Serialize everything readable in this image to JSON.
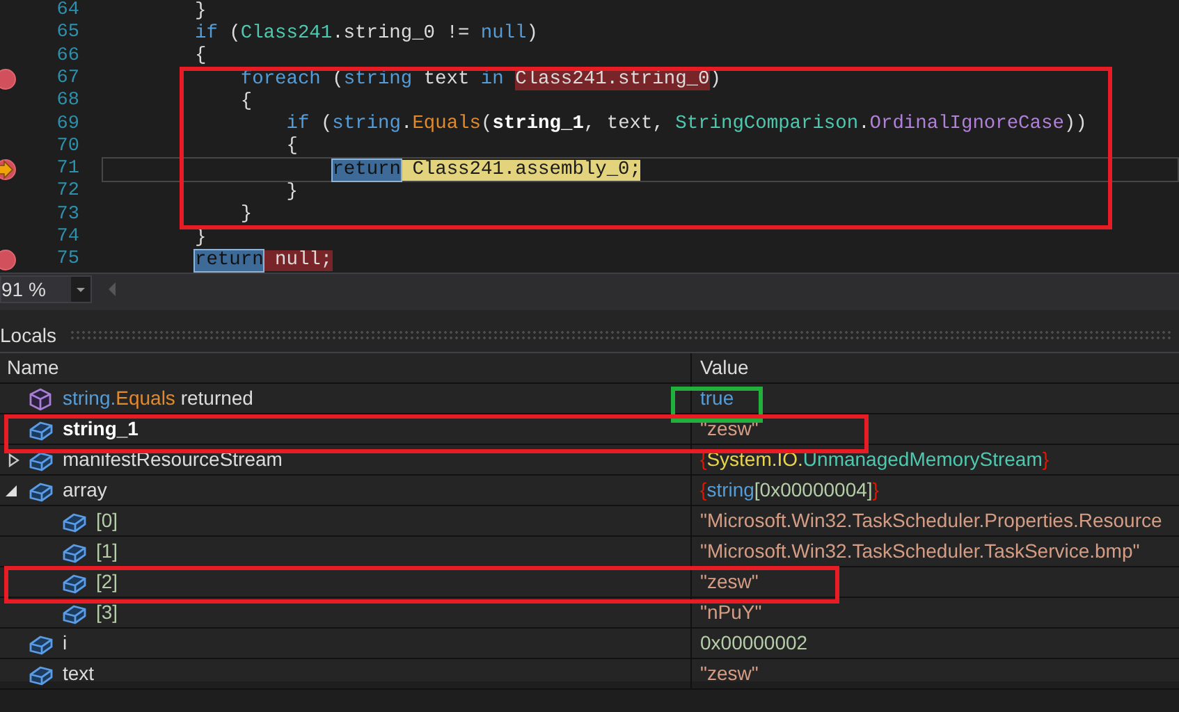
{
  "editor": {
    "lines": [
      {
        "number": "64",
        "breakpoint": false,
        "current": false,
        "tokens": [
          {
            "text": "}",
            "kind": "plain"
          }
        ]
      },
      {
        "number": "65",
        "breakpoint": false,
        "current": false,
        "tokens": [
          {
            "text": "if",
            "kind": "keyword"
          },
          {
            "text": " (",
            "kind": "plain"
          },
          {
            "text": "Class241",
            "kind": "type"
          },
          {
            "text": ".string_0 != ",
            "kind": "plain"
          },
          {
            "text": "null",
            "kind": "keyword"
          },
          {
            "text": ")",
            "kind": "plain"
          }
        ]
      },
      {
        "number": "66",
        "breakpoint": false,
        "current": false,
        "tokens": [
          {
            "text": "{",
            "kind": "plain"
          }
        ]
      },
      {
        "number": "67",
        "breakpoint": true,
        "current": false,
        "tokens": [
          {
            "text": "foreach",
            "kind": "keyword"
          },
          {
            "text": " (",
            "kind": "plain"
          },
          {
            "text": "string",
            "kind": "keyword"
          },
          {
            "text": " text ",
            "kind": "plain"
          },
          {
            "text": "in ",
            "kind": "keyword"
          },
          {
            "text": "Class241.string_0",
            "kind": "breakpoint-span"
          },
          {
            "text": ")",
            "kind": "plain"
          }
        ]
      },
      {
        "number": "68",
        "breakpoint": false,
        "current": false,
        "tokens": [
          {
            "text": "{",
            "kind": "plain"
          }
        ]
      },
      {
        "number": "69",
        "breakpoint": false,
        "current": false,
        "tokens": [
          {
            "text": "if",
            "kind": "keyword"
          },
          {
            "text": " (",
            "kind": "plain"
          },
          {
            "text": "string",
            "kind": "keyword"
          },
          {
            "text": ".",
            "kind": "plain"
          },
          {
            "text": "Equals",
            "kind": "method"
          },
          {
            "text": "(",
            "kind": "plain"
          },
          {
            "text": "string_1",
            "kind": "bold"
          },
          {
            "text": ", text, ",
            "kind": "plain"
          },
          {
            "text": "StringComparison",
            "kind": "type"
          },
          {
            "text": ".",
            "kind": "plain"
          },
          {
            "text": "OrdinalIgnoreCase",
            "kind": "enum"
          },
          {
            "text": "))",
            "kind": "plain"
          }
        ]
      },
      {
        "number": "70",
        "breakpoint": false,
        "current": false,
        "tokens": [
          {
            "text": "{",
            "kind": "plain"
          }
        ]
      },
      {
        "number": "71",
        "breakpoint": true,
        "current": true,
        "tokens": [
          {
            "text": "return",
            "kind": "step-keyword"
          },
          {
            "text": " Class241.assembly_0;",
            "kind": "current-span"
          }
        ]
      },
      {
        "number": "72",
        "breakpoint": false,
        "current": false,
        "tokens": [
          {
            "text": "}",
            "kind": "plain"
          }
        ]
      },
      {
        "number": "73",
        "breakpoint": false,
        "current": false,
        "tokens": [
          {
            "text": "}",
            "kind": "plain"
          }
        ]
      },
      {
        "number": "74",
        "breakpoint": false,
        "current": false,
        "tokens": [
          {
            "text": "}",
            "kind": "plain"
          }
        ]
      },
      {
        "number": "75",
        "breakpoint": true,
        "current": false,
        "tokens": [
          {
            "text": "return",
            "kind": "step-keyword"
          },
          {
            "text": " null;",
            "kind": "breakpoint-span"
          }
        ]
      }
    ]
  },
  "zoom": {
    "value": "91 %"
  },
  "locals": {
    "title": "Locals",
    "columns": [
      "Name",
      "Value"
    ],
    "rows": [
      {
        "kind": "return-value",
        "bold": false,
        "name": [
          {
            "text": "string.",
            "kind": "keyword"
          },
          {
            "text": "Equals",
            "kind": "method"
          },
          {
            "text": " returned",
            "kind": "plain"
          }
        ],
        "value": [
          {
            "text": "true",
            "kind": "keyword"
          }
        ]
      },
      {
        "kind": "variable",
        "bold": true,
        "name": [
          {
            "text": "string_1",
            "kind": "plain"
          }
        ],
        "value": [
          {
            "text": "\"zesw\"",
            "kind": "string"
          }
        ]
      },
      {
        "kind": "variable",
        "bold": false,
        "expanded": false,
        "name": [
          {
            "text": "manifestResourceStream",
            "kind": "plain"
          }
        ],
        "value": [
          {
            "text": "{",
            "kind": "brace"
          },
          {
            "text": "System.IO.",
            "kind": "namespace"
          },
          {
            "text": "UnmanagedMemoryStream",
            "kind": "type"
          },
          {
            "text": "}",
            "kind": "brace"
          }
        ]
      },
      {
        "kind": "variable",
        "bold": false,
        "expanded": true,
        "name": [
          {
            "text": "array",
            "kind": "plain"
          }
        ],
        "value": [
          {
            "text": "{",
            "kind": "brace"
          },
          {
            "text": "string",
            "kind": "keyword"
          },
          {
            "text": "[0x00000004]",
            "kind": "number"
          },
          {
            "text": "}",
            "kind": "brace"
          }
        ],
        "children": [
          {
            "kind": "variable",
            "bold": false,
            "name": [
              {
                "text": "[0]",
                "kind": "number"
              }
            ],
            "value": [
              {
                "text": "\"Microsoft.Win32.TaskScheduler.Properties.Resource",
                "kind": "string"
              }
            ]
          },
          {
            "kind": "variable",
            "bold": false,
            "name": [
              {
                "text": "[1]",
                "kind": "number"
              }
            ],
            "value": [
              {
                "text": "\"Microsoft.Win32.TaskScheduler.TaskService.bmp\"",
                "kind": "string"
              }
            ]
          },
          {
            "kind": "variable",
            "bold": false,
            "name": [
              {
                "text": "[2]",
                "kind": "number"
              }
            ],
            "value": [
              {
                "text": "\"zesw\"",
                "kind": "string"
              }
            ]
          },
          {
            "kind": "variable",
            "bold": false,
            "name": [
              {
                "text": "[3]",
                "kind": "number"
              }
            ],
            "value": [
              {
                "text": "\"nPuY\"",
                "kind": "string"
              }
            ]
          }
        ]
      },
      {
        "kind": "variable",
        "bold": false,
        "name": [
          {
            "text": "i",
            "kind": "plain"
          }
        ],
        "value": [
          {
            "text": "0x00000002",
            "kind": "number"
          }
        ]
      },
      {
        "kind": "variable",
        "bold": false,
        "name": [
          {
            "text": "text",
            "kind": "plain"
          }
        ],
        "value": [
          {
            "text": "\"zesw\"",
            "kind": "string"
          }
        ]
      }
    ]
  },
  "annotations": [
    {
      "color": "#e81c24"
    },
    {
      "color": "#22b03c"
    },
    {
      "color": "#e81c24"
    },
    {
      "color": "#e81c24"
    }
  ]
}
